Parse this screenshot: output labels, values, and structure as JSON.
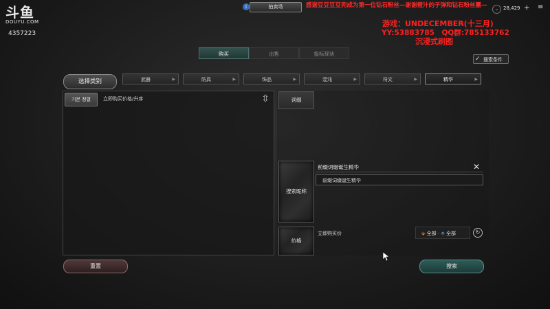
{
  "watermark": {
    "logo": "斗鱼",
    "site": "DOUYU.COM",
    "room": "4357223"
  },
  "topbar": {
    "center_tab": "拍卖场",
    "gold": "28,429",
    "info_glyph": "i",
    "chevron_glyph": "⌄",
    "plus_glyph": "+",
    "menu_glyph": "≡"
  },
  "overlay": {
    "marquee": "感谢豆豆豆豆兜成为第一位钻石粉丝—谢谢橙汁的子弹和钻石粉丝團—",
    "line1": "游戏：UNDECEMBER(十三月)",
    "line2": "YY:53883785　QQ群:785133762",
    "line3": "沉浸式刷图"
  },
  "tabs": [
    {
      "label": "购买",
      "active": true
    },
    {
      "label": "出售",
      "active": false
    },
    {
      "label": "投标现状",
      "active": false
    }
  ],
  "search_conditions": "搜索条件",
  "select_category": "选择类别",
  "categories": [
    {
      "label": "武器"
    },
    {
      "label": "防具"
    },
    {
      "label": "饰品"
    },
    {
      "label": "混沌"
    },
    {
      "label": "符文"
    },
    {
      "label": "精华"
    }
  ],
  "left_panel": {
    "basic_info": "기본 정렬",
    "sort_label": "立即购买价格/升序"
  },
  "right_panel": {
    "tag_label": "词缀",
    "search_name": "搜索昵称",
    "filter_header": "前缀词缀诞生精华",
    "filter_value": "前缀词缀诞生精华",
    "price_tile": "价格",
    "price_label": "立即购买价",
    "grade_up": "全部",
    "grade_down": "全部"
  },
  "buttons": {
    "reset": "重置",
    "search": "搜索"
  },
  "colors": {
    "accent": "#2e5c58",
    "danger": "#503838",
    "overlay_red": "#ff2020"
  }
}
